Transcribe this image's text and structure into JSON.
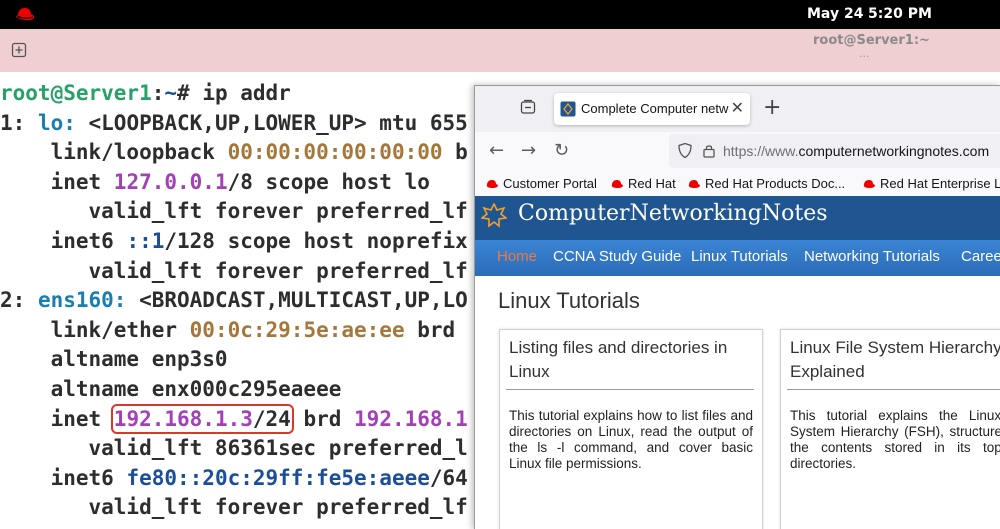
{
  "topbar": {
    "date": "May 24",
    "time": "5:20 PM",
    "logo_icon": "redhat-logo-icon"
  },
  "terminal_header": {
    "title": "root@Server1:~",
    "subtitle": "..."
  },
  "terminal": {
    "lines": [
      {
        "segments": [
          {
            "t": "root@Server1",
            "c": "green"
          },
          {
            "t": ":",
            "c": ""
          },
          {
            "t": "~",
            "c": "blue"
          },
          {
            "t": "# ip addr",
            "c": ""
          }
        ]
      },
      {
        "segments": [
          {
            "t": "1: ",
            "c": ""
          },
          {
            "t": "lo:",
            "c": "teal"
          },
          {
            "t": " <LOOPBACK,UP,LOWER_UP> mtu 655",
            "c": ""
          }
        ]
      },
      {
        "segments": [
          {
            "t": "    link/loopback ",
            "c": ""
          },
          {
            "t": "00:00:00:00:00:00",
            "c": "brown"
          },
          {
            "t": " b",
            "c": ""
          }
        ]
      },
      {
        "segments": [
          {
            "t": "    inet ",
            "c": ""
          },
          {
            "t": "127.0.0.1",
            "c": "purple"
          },
          {
            "t": "/8 scope host lo",
            "c": ""
          }
        ]
      },
      {
        "segments": [
          {
            "t": "       valid_lft forever preferred_lf",
            "c": ""
          }
        ]
      },
      {
        "segments": [
          {
            "t": "    inet6 ",
            "c": ""
          },
          {
            "t": "::1",
            "c": "blue"
          },
          {
            "t": "/128 scope host noprefix",
            "c": ""
          }
        ]
      },
      {
        "segments": [
          {
            "t": "       valid_lft forever preferred_lf",
            "c": ""
          }
        ]
      },
      {
        "segments": [
          {
            "t": "2: ",
            "c": ""
          },
          {
            "t": "ens160:",
            "c": "teal"
          },
          {
            "t": " <BROADCAST,MULTICAST,UP,LO",
            "c": ""
          }
        ]
      },
      {
        "segments": [
          {
            "t": "    link/ether ",
            "c": ""
          },
          {
            "t": "00:0c:29:5e:ae:ee",
            "c": "brown"
          },
          {
            "t": " brd",
            "c": ""
          }
        ]
      },
      {
        "segments": [
          {
            "t": "    altname enp3s0",
            "c": ""
          }
        ]
      },
      {
        "segments": [
          {
            "t": "    altname enx000c295eaeee",
            "c": ""
          }
        ]
      },
      {
        "segments": [
          {
            "t": "    inet ",
            "c": ""
          },
          {
            "t": "192.168.1.3",
            "c": "purple ip"
          },
          {
            "t": "/24",
            "c": "ip"
          },
          {
            "t": " brd ",
            "c": ""
          },
          {
            "t": "192.168.1",
            "c": "purple"
          }
        ]
      },
      {
        "segments": [
          {
            "t": "       valid_lft 86361sec preferred_l",
            "c": ""
          }
        ]
      },
      {
        "segments": [
          {
            "t": "    inet6 ",
            "c": ""
          },
          {
            "t": "fe80::20c:29ff:fe5e:aeee",
            "c": "blue"
          },
          {
            "t": "/64",
            "c": ""
          }
        ]
      },
      {
        "segments": [
          {
            "t": "       valid_lft forever preferred_lf",
            "c": ""
          }
        ]
      }
    ]
  },
  "browser": {
    "tab": {
      "title": "Complete Computer netw",
      "close": "✕"
    },
    "new_tab": "+",
    "nav": {
      "back": "←",
      "forward": "→",
      "reload": "↻"
    },
    "url": {
      "prefix": "https://www.",
      "domain": "computernetworkingnotes.com"
    },
    "bookmarks": [
      {
        "label": "Customer Portal"
      },
      {
        "label": "Red Hat"
      },
      {
        "label": "Red Hat Products Doc..."
      },
      {
        "label": "Red Hat Enterprise L"
      }
    ],
    "site": {
      "name": "ComputerNetworkingNotes",
      "nav": [
        "Home",
        "CCNA Study Guide",
        "Linux Tutorials",
        "Networking Tutorials",
        "Caree"
      ],
      "active_nav": "Home",
      "heading": "Linux Tutorials",
      "cards": [
        {
          "title": "Listing files and directories in Linux",
          "text": "This tutorial explains how to list files and directories on Linux, read the output of the ls -l command, and cover basic Linux file permissions."
        },
        {
          "title": "Linux File System Hierarchy Explained",
          "text": "This tutorial explains the Linux File System Hierarchy (FSH), structure, and the contents stored in its top-level directories."
        }
      ]
    }
  },
  "colors": {
    "terminal_header_bg": "#f0cfd2",
    "site_header_bg": "#1f5692",
    "site_nav_bg": "#3276c3",
    "active_nav": "#f0783c",
    "prompt_green": "#26a269",
    "highlight_box": "#d9382c"
  }
}
